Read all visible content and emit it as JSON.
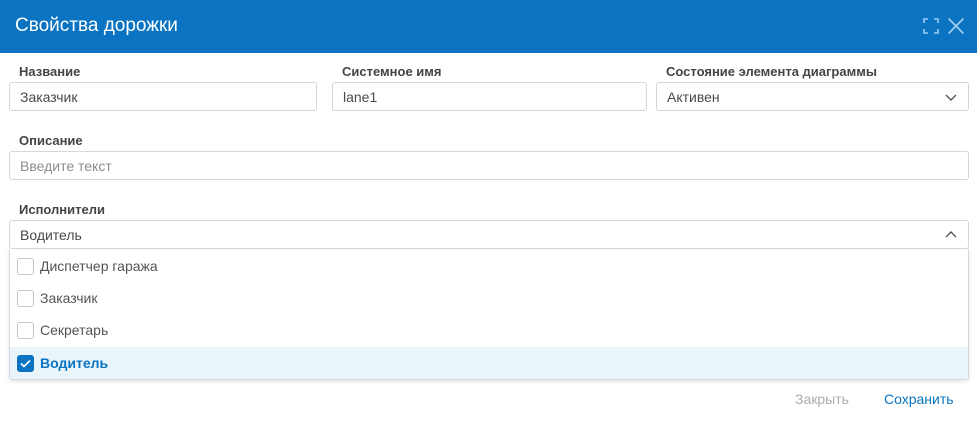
{
  "dialog": {
    "title": "Свойства дорожки",
    "colors": {
      "header": "#0a74c2",
      "accent": "#0a74c2",
      "selected_row": "#e9f4fb"
    }
  },
  "fields": {
    "name": {
      "label": "Название",
      "value": "Заказчик"
    },
    "system_name": {
      "label": "Системное имя",
      "value": "lane1"
    },
    "state": {
      "label": "Состояние элемента диаграммы",
      "value": "Активен"
    },
    "description": {
      "label": "Описание",
      "placeholder": "Введите текст"
    },
    "performers": {
      "label": "Исполнители",
      "value": "Водитель",
      "options": [
        {
          "label": "Диспетчер гаража",
          "checked": false
        },
        {
          "label": "Заказчик",
          "checked": false
        },
        {
          "label": "Секретарь",
          "checked": false
        },
        {
          "label": "Водитель",
          "checked": true
        }
      ]
    }
  },
  "footer": {
    "close_label": "Закрыть",
    "save_label": "Сохранить"
  },
  "icons": {
    "expand": "fullscreen-icon",
    "close": "close-icon",
    "dropdown": "chevron-icon",
    "check": "checkmark-icon"
  }
}
